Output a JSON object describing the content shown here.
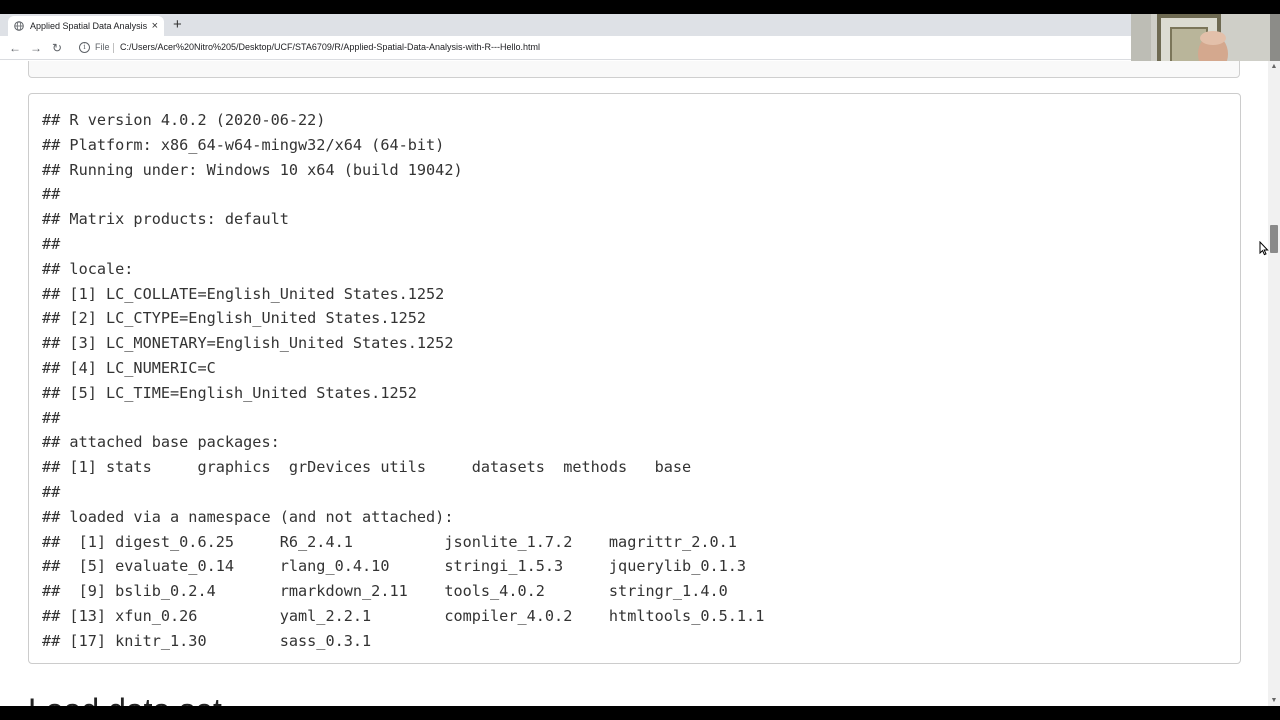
{
  "browser": {
    "tab_title": "Applied Spatial Data Analysis wit",
    "tab_close": "×",
    "new_tab": "+",
    "file_label": "File",
    "url": "C:/Users/Acer%20Nitro%205/Desktop/UCF/STA6709/R/Applied-Spatial-Data-Analysis-with-R---Hello.html"
  },
  "output": {
    "text": "## R version 4.0.2 (2020-06-22)\n## Platform: x86_64-w64-mingw32/x64 (64-bit)\n## Running under: Windows 10 x64 (build 19042)\n## \n## Matrix products: default\n## \n## locale:\n## [1] LC_COLLATE=English_United States.1252 \n## [2] LC_CTYPE=English_United States.1252   \n## [3] LC_MONETARY=English_United States.1252\n## [4] LC_NUMERIC=C                          \n## [5] LC_TIME=English_United States.1252    \n## \n## attached base packages:\n## [1] stats     graphics  grDevices utils     datasets  methods   base     \n## \n## loaded via a namespace (and not attached):\n##  [1] digest_0.6.25     R6_2.4.1          jsonlite_1.7.2    magrittr_2.0.1   \n##  [5] evaluate_0.14     rlang_0.4.10      stringi_1.5.3     jquerylib_0.1.3  \n##  [9] bslib_0.2.4       rmarkdown_2.11    tools_4.0.2       stringr_1.4.0    \n## [13] xfun_0.26         yaml_2.2.1        compiler_4.0.2    htmltools_0.5.1.1\n## [17] knitr_1.30        sass_0.3.1"
  },
  "next_heading": "Load data set"
}
